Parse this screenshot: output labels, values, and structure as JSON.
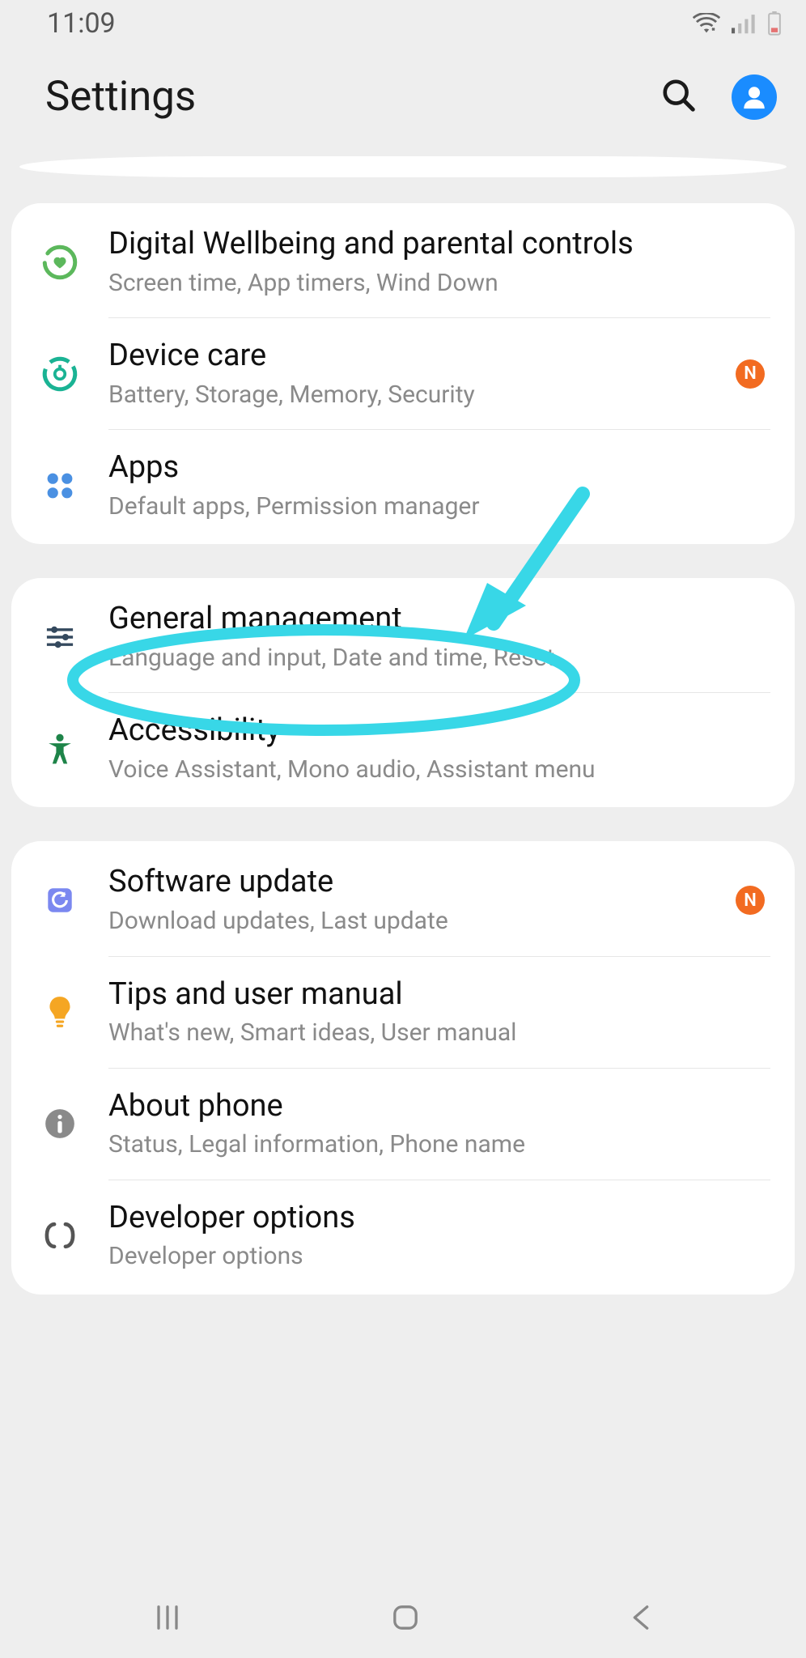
{
  "status": {
    "time": "11:09"
  },
  "header": {
    "title": "Settings"
  },
  "groups": [
    {
      "items": [
        {
          "title": "Digital Wellbeing and parental controls",
          "sub": "Screen time, App timers, Wind Down",
          "badge": ""
        },
        {
          "title": "Device care",
          "sub": "Battery, Storage, Memory, Security",
          "badge": "N"
        },
        {
          "title": "Apps",
          "sub": "Default apps, Permission manager",
          "badge": ""
        }
      ]
    },
    {
      "items": [
        {
          "title": "General management",
          "sub": "Language and input, Date and time, Reset",
          "badge": ""
        },
        {
          "title": "Accessibility",
          "sub": "Voice Assistant, Mono audio, Assistant menu",
          "badge": ""
        }
      ]
    },
    {
      "items": [
        {
          "title": "Software update",
          "sub": "Download updates, Last update",
          "badge": "N"
        },
        {
          "title": "Tips and user manual",
          "sub": "What's new, Smart ideas, User manual",
          "badge": ""
        },
        {
          "title": "About phone",
          "sub": "Status, Legal information, Phone name",
          "badge": ""
        },
        {
          "title": "Developer options",
          "sub": "Developer options",
          "badge": ""
        }
      ]
    }
  ]
}
